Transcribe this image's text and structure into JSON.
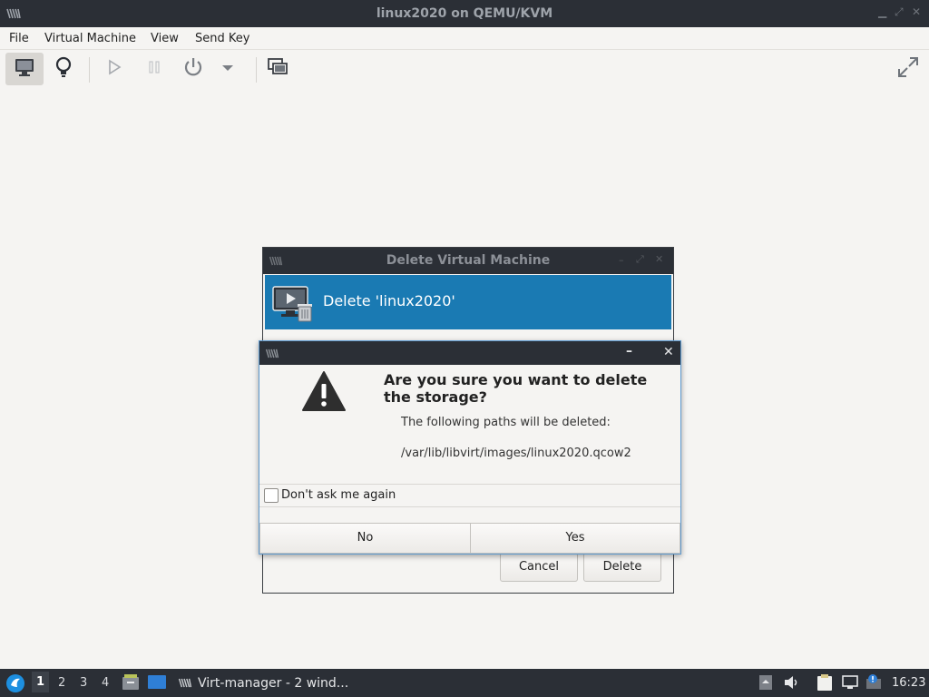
{
  "window": {
    "title": "linux2020 on QEMU/KVM",
    "minimize_glyph": "▁",
    "maximize_glyph": "⤢",
    "close_glyph": "✕"
  },
  "menubar": {
    "items": [
      "File",
      "Virtual Machine",
      "View",
      "Send Key"
    ]
  },
  "toolbar": {
    "icons": [
      "console-monitor-icon",
      "details-lightbulb-icon",
      "run-icon",
      "pause-icon",
      "power-icon",
      "power-menu-chevron-icon",
      "snapshots-icon",
      "fullscreen-icon"
    ]
  },
  "delete_dialog": {
    "title": "Delete Virtual Machine",
    "banner_text": "Delete 'linux2020'",
    "cancel_label": "Cancel",
    "delete_label": "Delete"
  },
  "confirm_dialog": {
    "minimize_glyph": "–",
    "close_glyph": "✕",
    "heading": "Are you sure you want to delete the storage?",
    "subtext": "The following paths will be deleted:",
    "path": "/var/lib/libvirt/images/linux2020.qcow2",
    "checkbox_label": "Don't ask me again",
    "checkbox_checked": false,
    "no_label": "No",
    "yes_label": "Yes"
  },
  "taskbar": {
    "workspaces": [
      "1",
      "2",
      "3",
      "4"
    ],
    "current_workspace": "1",
    "task_label": "Virt-manager - 2 wind...",
    "clock": "16:23"
  },
  "colors": {
    "titlebar": "#2b2f36",
    "banner": "#1a7ab3",
    "dialog_border": "#5f9bd1"
  }
}
